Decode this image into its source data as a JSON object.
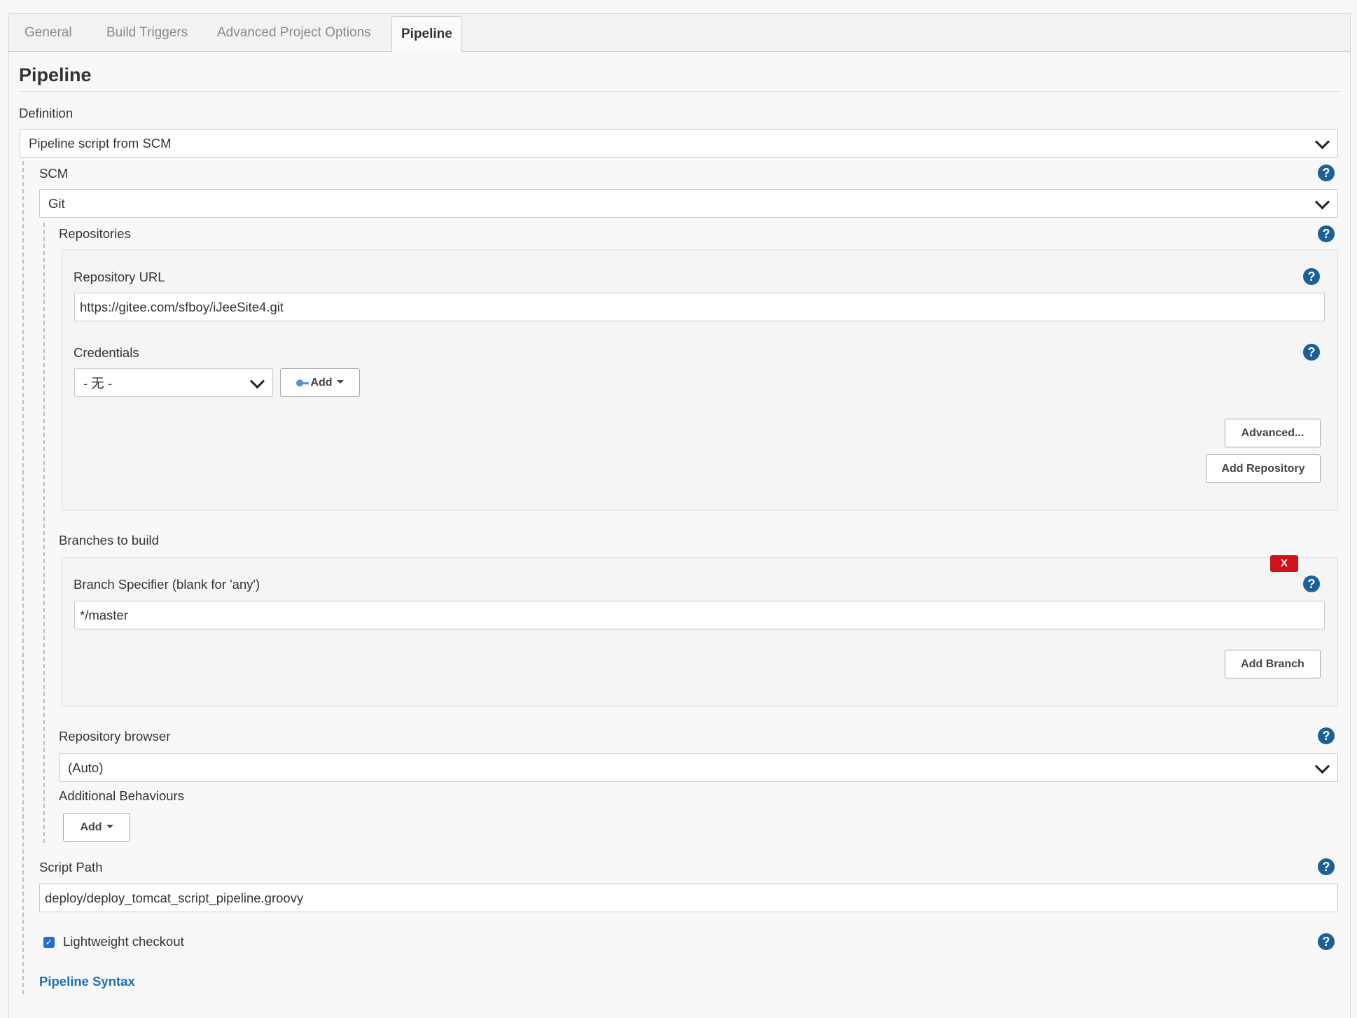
{
  "tabs": [
    {
      "label": "General",
      "active": false
    },
    {
      "label": "Build Triggers",
      "active": false
    },
    {
      "label": "Advanced Project Options",
      "active": false
    },
    {
      "label": "Pipeline",
      "active": true
    }
  ],
  "pipeline": {
    "title": "Pipeline",
    "definition_label": "Definition",
    "definition_value": "Pipeline script from SCM",
    "scm_label": "SCM",
    "scm_value": "Git",
    "repositories_label": "Repositories",
    "repository_url_label": "Repository URL",
    "repository_url_value": "https://gitee.com/sfboy/iJeeSite4.git",
    "credentials_label": "Credentials",
    "credentials_value": "- 无 -",
    "credentials_add_label": "Add",
    "advanced_label": "Advanced...",
    "add_repository_label": "Add Repository",
    "branches_label": "Branches to build",
    "branch_specifier_label": "Branch Specifier (blank for 'any')",
    "branch_specifier_value": "*/master",
    "delete_label": "X",
    "add_branch_label": "Add Branch",
    "repo_browser_label": "Repository browser",
    "repo_browser_value": "(Auto)",
    "additional_behaviours_label": "Additional Behaviours",
    "additional_add_label": "Add",
    "script_path_label": "Script Path",
    "script_path_value": "deploy/deploy_tomcat_script_pipeline.groovy",
    "lightweight_label": "Lightweight checkout",
    "lightweight_checked": true,
    "pipeline_syntax_label": "Pipeline Syntax",
    "help_glyph": "?"
  },
  "colors": {
    "help": "#1d5f97",
    "link": "#1d6fb5",
    "delete": "#d0121b",
    "checkbox": "#1f6fd0"
  }
}
